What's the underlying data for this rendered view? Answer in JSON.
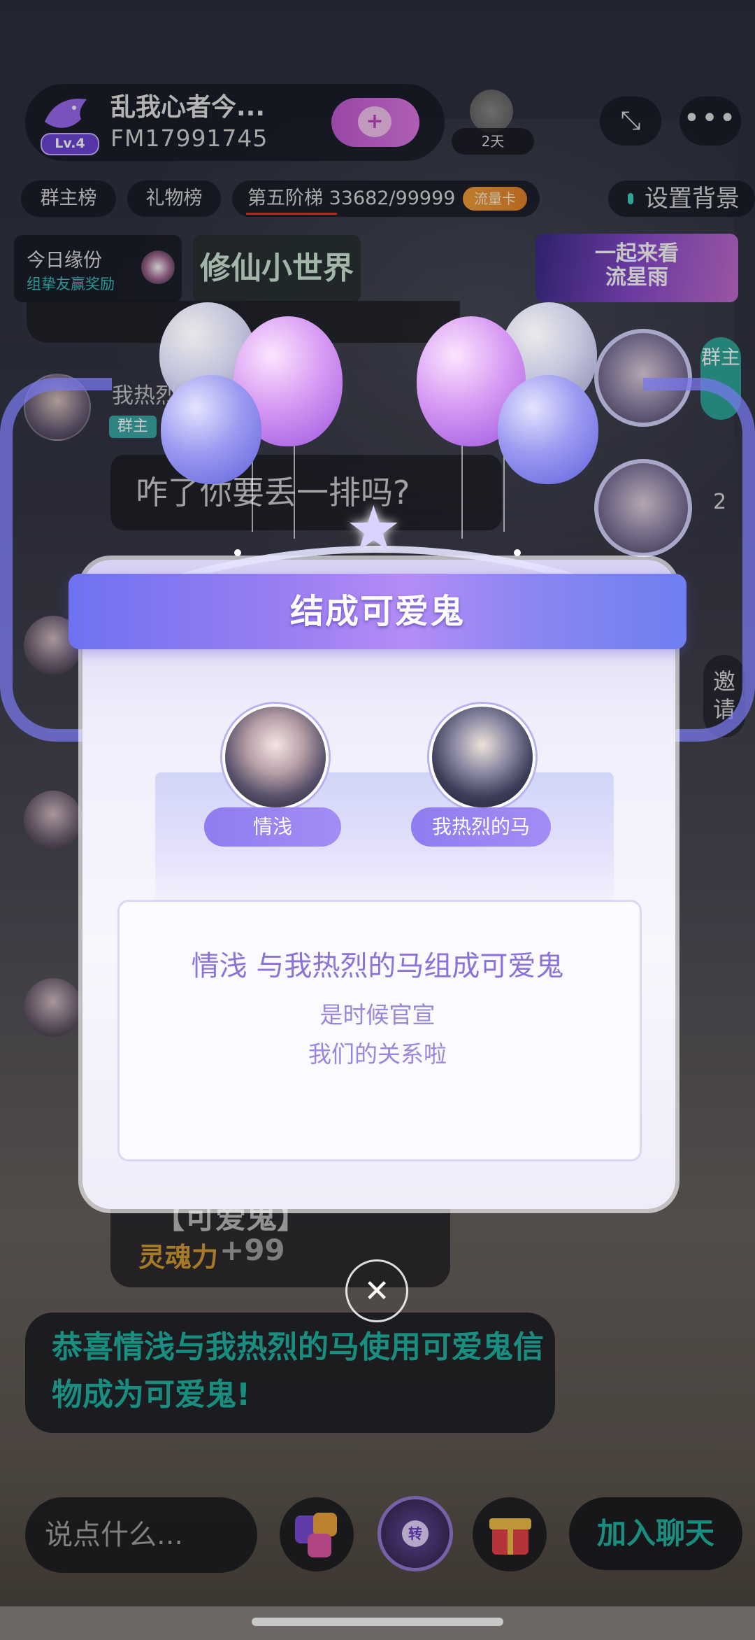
{
  "room": {
    "name": "乱我心者今...",
    "id": "FM17991745",
    "level": "Lv.4",
    "days": "2天"
  },
  "ranks": {
    "group_rank": "群主榜",
    "gift_rank": "礼物榜",
    "ladder": "第五阶梯 33682/99999",
    "flow_card": "流量卡",
    "set_bg": "设置背景"
  },
  "fate": {
    "title": "今日缘份",
    "subtitle": "组挚友赢奖励"
  },
  "banners": {
    "xiuxian": "修仙小世界",
    "meteor_line1": "一起来看",
    "meteor_line2": "流星雨"
  },
  "chat": {
    "user_name": "我热烈",
    "group_tag": "群主",
    "bubble": "咋了你要丢一排吗?",
    "right_tag": "群主",
    "right_num": "2",
    "invite": "邀请",
    "lower_bubble_title": "【可爱鬼】",
    "soul_label": "灵魂力",
    "soul_value": "+99",
    "congrats": "恭喜情浅与我热烈的马使用可爱鬼信物成为可爱鬼!"
  },
  "modal": {
    "title": "结成可爱鬼",
    "left_name": "情浅",
    "right_name": "我热烈的马",
    "message_line1": "情浅 与我热烈的马组成可爱鬼",
    "message_line2": "是时候官宣",
    "message_line3": "我们的关系啦",
    "close_icon": "close-icon"
  },
  "bottom": {
    "input_placeholder": "说点什么...",
    "wheel_label": "转",
    "join_label": "加入聊天"
  },
  "colors": {
    "accent_purple": "#8a72d8",
    "teal": "#20b6a5",
    "orange": "#f2a23b"
  }
}
